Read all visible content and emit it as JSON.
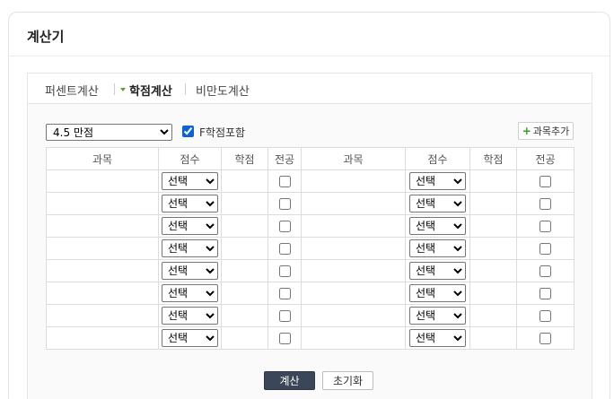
{
  "card": {
    "title": "계산기"
  },
  "tabs": [
    {
      "label": "퍼센트계산",
      "active": false
    },
    {
      "label": "학점계산",
      "active": true
    },
    {
      "label": "비만도계산",
      "active": false
    }
  ],
  "controls": {
    "scale_selected": "4.5 만점",
    "include_f_label": "F학점포함",
    "include_f_checked": true,
    "add_course_label": "과목추가"
  },
  "table": {
    "headers": [
      "과목",
      "점수",
      "학점",
      "전공",
      "과목",
      "점수",
      "학점",
      "전공"
    ],
    "row_count": 8,
    "score_placeholder": "선택"
  },
  "buttons": {
    "calculate": "계산",
    "reset": "초기화"
  },
  "colors": {
    "accent_green": "#5aa02c",
    "calc_button_bg": "#3b4658",
    "checkbox_blue": "#0b63d6"
  }
}
